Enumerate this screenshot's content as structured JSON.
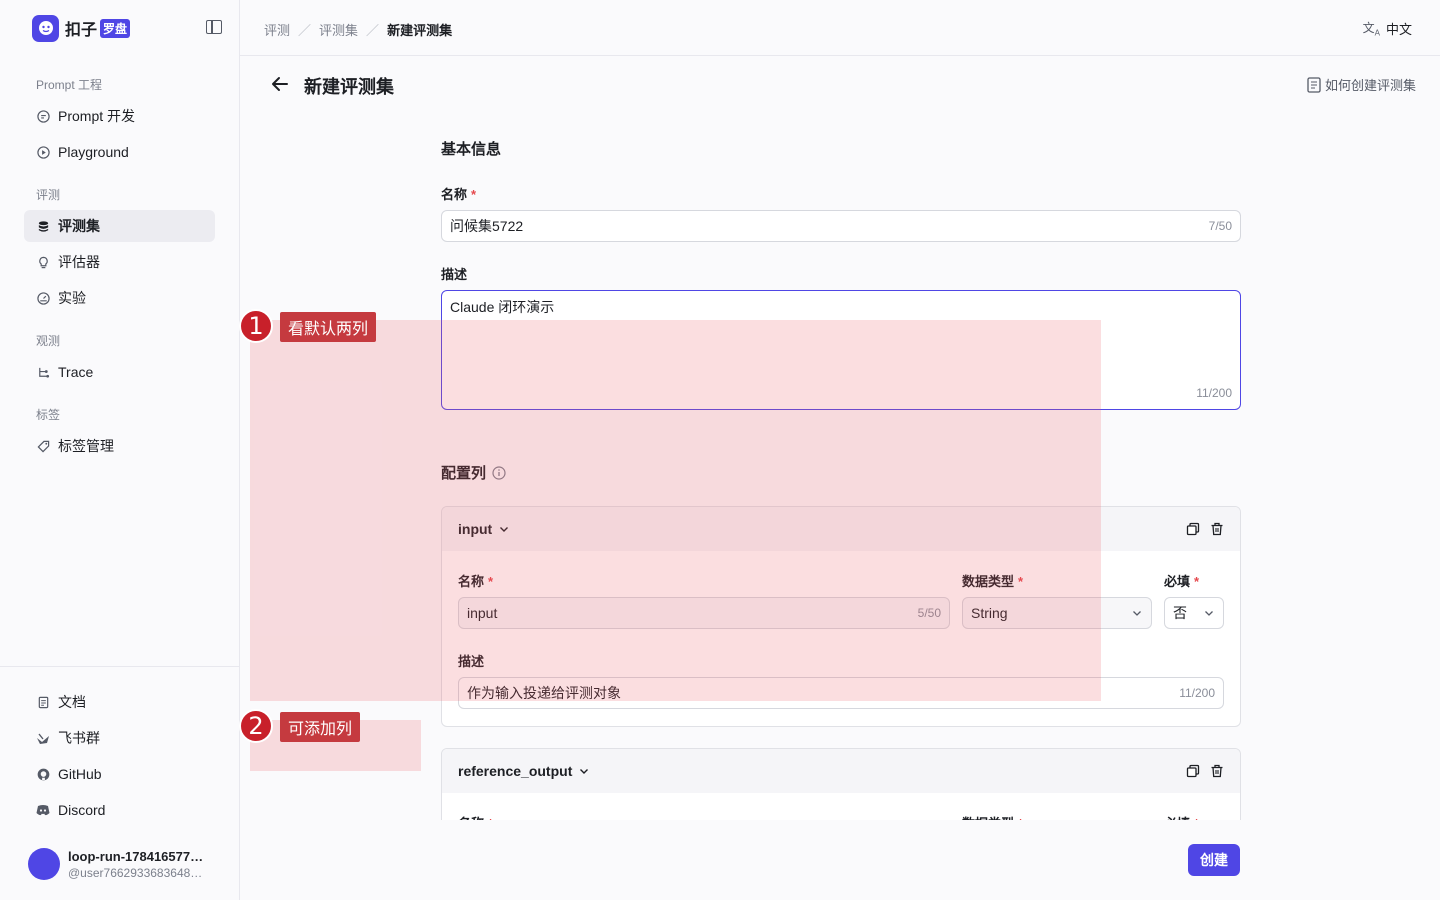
{
  "app": {
    "name": "扣子",
    "badge": "罗盘"
  },
  "sidebar": {
    "groups": [
      {
        "label": "Prompt 工程",
        "items": [
          {
            "label": "Prompt 开发",
            "icon": "prompt-icon"
          },
          {
            "label": "Playground",
            "icon": "play-icon"
          }
        ]
      },
      {
        "label": "评测",
        "items": [
          {
            "label": "评测集",
            "icon": "database-icon",
            "active": true
          },
          {
            "label": "评估器",
            "icon": "bulb-icon"
          },
          {
            "label": "实验",
            "icon": "gauge-icon"
          }
        ]
      },
      {
        "label": "观测",
        "items": [
          {
            "label": "Trace",
            "icon": "trace-icon"
          }
        ]
      },
      {
        "label": "标签",
        "items": [
          {
            "label": "标签管理",
            "icon": "tag-icon"
          }
        ]
      }
    ],
    "footer": [
      {
        "label": "文档",
        "icon": "doc-icon"
      },
      {
        "label": "飞书群",
        "icon": "feishu-icon"
      },
      {
        "label": "GitHub",
        "icon": "github-icon"
      },
      {
        "label": "Discord",
        "icon": "discord-icon"
      }
    ],
    "user": {
      "name": "loop-run-178416577…",
      "handle": "@user7662933683648…"
    }
  },
  "topbar": {
    "breadcrumb": [
      "评测",
      "评测集",
      "新建评测集"
    ],
    "language": "中文"
  },
  "page": {
    "title": "新建评测集",
    "help": "如何创建评测集"
  },
  "form": {
    "basic_title": "基本信息",
    "name_label": "名称",
    "name_value": "问候集5722",
    "name_counter": "7/50",
    "desc_label": "描述",
    "desc_value": "Claude 闭环演示",
    "desc_counter": "11/200",
    "columns_title": "配置列",
    "columns": [
      {
        "title": "input",
        "name_label": "名称",
        "name_value": "input",
        "name_counter": "5/50",
        "type_label": "数据类型",
        "type_value": "String",
        "required_label": "必填",
        "required_value": "否",
        "desc_label": "描述",
        "desc_value": "作为输入投递给评测对象",
        "desc_counter": "11/200"
      },
      {
        "title": "reference_output",
        "name_label": "名称",
        "type_label": "数据类型",
        "required_label": "必填"
      }
    ],
    "submit": "创建"
  },
  "annotations": [
    {
      "number": "1",
      "text": "看默认两列"
    },
    {
      "number": "2",
      "text": "可添加列"
    }
  ],
  "colors": {
    "accent": "#4f46e5",
    "required": "#e5484d",
    "annotation": "#c53a3f"
  }
}
